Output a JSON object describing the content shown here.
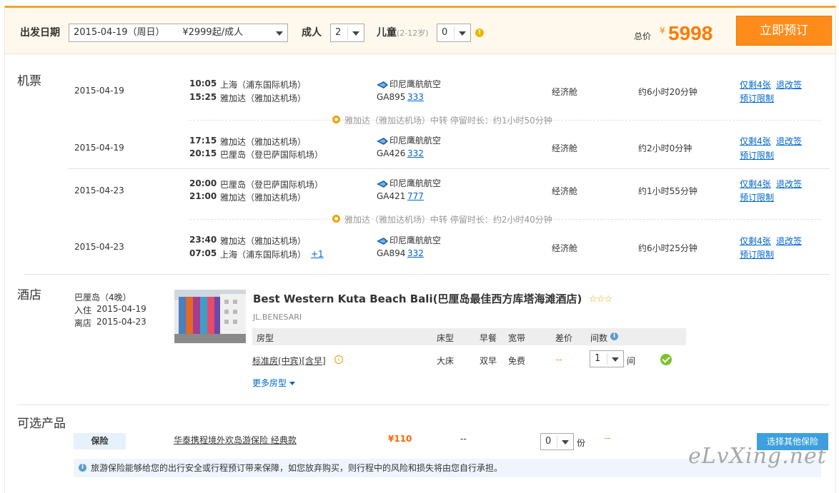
{
  "topbar": {
    "depart_label": "出发日期",
    "depart_value": "2015-04-19（周日）      ¥2999起/成人",
    "adult_label": "成人",
    "adult_value": "2",
    "child_label": "儿童",
    "child_hint": "(2-12岁)",
    "child_value": "0",
    "total_label": "总价",
    "currency": "¥",
    "total_price": "5998",
    "book_button": "立即预订"
  },
  "flights": {
    "section_title": "机票",
    "segments": [
      {
        "date": "2015-04-19",
        "dep_time": "10:05",
        "dep_airport": "上海（浦东国际机场）",
        "arr_time": "15:25",
        "arr_airport": "雅加达（雅加达机场）",
        "plus_day": "",
        "airline": "印尼鹰航航空",
        "flight_no": "GA895",
        "plane": "333",
        "cabin": "经济舱",
        "duration": "约6小时20分钟",
        "remain": "仅剩4张",
        "change": "退改签",
        "limit": "预订限制"
      },
      {
        "date": "2015-04-19",
        "dep_time": "17:15",
        "dep_airport": "雅加达（雅加达机场）",
        "arr_time": "20:15",
        "arr_airport": "巴厘岛（登巴萨国际机场）",
        "plus_day": "",
        "airline": "印尼鹰航航空",
        "flight_no": "GA426",
        "plane": "332",
        "cabin": "经济舱",
        "duration": "约2小时0分钟",
        "remain": "仅剩4张",
        "change": "退改签",
        "limit": "预订限制"
      },
      {
        "date": "2015-04-23",
        "dep_time": "20:00",
        "dep_airport": "巴厘岛（登巴萨国际机场）",
        "arr_time": "21:00",
        "arr_airport": "雅加达（雅加达机场）",
        "plus_day": "",
        "airline": "印尼鹰航航空",
        "flight_no": "GA421",
        "plane": "777",
        "cabin": "经济舱",
        "duration": "约1小时55分钟",
        "remain": "仅剩4张",
        "change": "退改签",
        "limit": "预订限制"
      },
      {
        "date": "2015-04-23",
        "dep_time": "23:40",
        "dep_airport": "雅加达（雅加达机场）",
        "arr_time": "07:05",
        "arr_airport": "上海（浦东国际机场）",
        "plus_day": "+1",
        "airline": "印尼鹰航航空",
        "flight_no": "GA894",
        "plane": "332",
        "cabin": "经济舱",
        "duration": "约6小时25分钟",
        "remain": "仅剩4张",
        "change": "退改签",
        "limit": "预订限制"
      }
    ],
    "transfers": [
      "雅加达（雅加达机场）中转 停留时长：约1小时50分钟",
      "雅加达（雅加达机场）中转 停留时长：约2小时40分钟"
    ]
  },
  "hotel": {
    "section_title": "酒店",
    "city": "巴厘岛（4晚）",
    "checkin_label": "入住",
    "checkin_date": "2015-04-19",
    "checkout_label": "离店",
    "checkout_date": "2015-04-23",
    "name": "Best Western Kuta Beach Bali(巴厘岛最佳西方库塔海滩酒店)",
    "stars": "☆☆☆",
    "address": "JL.BENESARI",
    "table_headers": [
      "房型",
      "床型",
      "早餐",
      "宽带",
      "差价",
      "间数"
    ],
    "room": {
      "name": "标准房(中宾)[含早]",
      "bed": "大床",
      "breakfast": "双早",
      "internet": "免费",
      "diff": "--",
      "count": "1",
      "unit": "间"
    },
    "more_rooms": "更多房型"
  },
  "optional": {
    "section_title": "可选产品",
    "tag": "保险",
    "product": "华泰携程境外欢岛游保险 经典款",
    "price": "¥110",
    "dash1": "--",
    "qty": "0",
    "qty_unit": "份",
    "dash2": "--",
    "other_button": "选择其他保险",
    "notice": "旅游保险能够给您的出行安全或行程预订带来保障，如您放弃购买，则行程中的风险和损失将由您自行承担。"
  },
  "watermark": "eLvXing.net",
  "colors": {
    "accent": "#ff8c1a",
    "link": "#0066cc",
    "topbar_bg": "#fff9ed",
    "border_top": "#f2a33a"
  }
}
